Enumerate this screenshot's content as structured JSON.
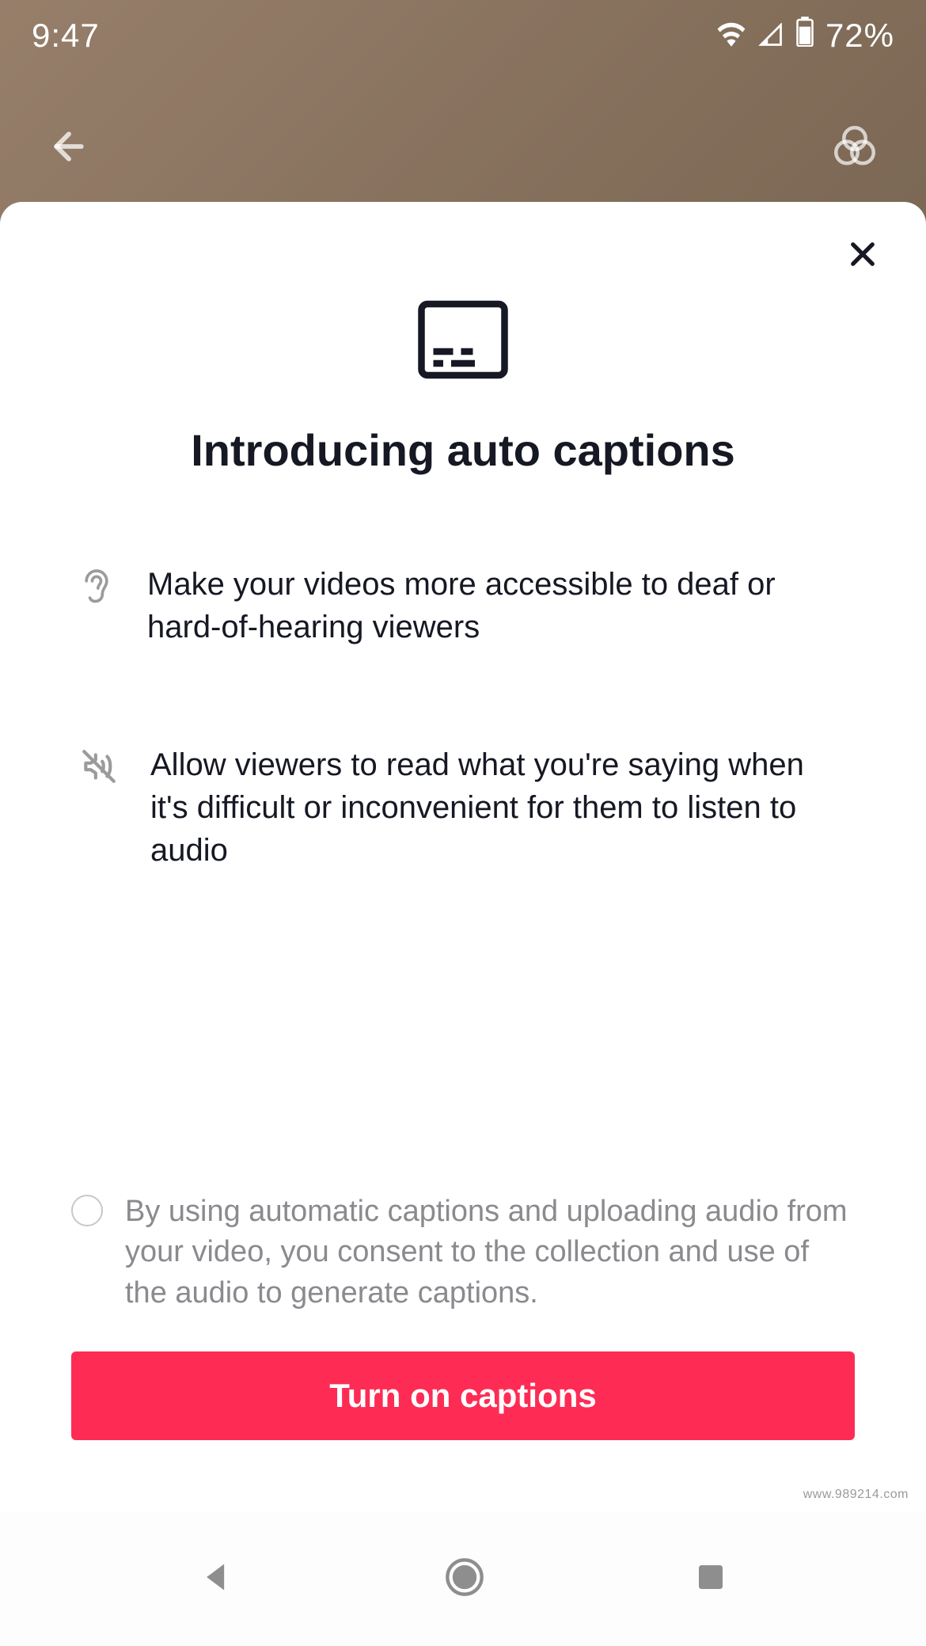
{
  "status": {
    "time": "9:47",
    "battery_percent": "72%"
  },
  "sheet": {
    "title": "Introducing auto captions",
    "bullets": [
      {
        "icon": "ear-icon",
        "text": "Make your videos more accessible to deaf or hard-of-hearing viewers"
      },
      {
        "icon": "sound-off-icon",
        "text": "Allow viewers to read what you're saying when it's difficult or inconvenient for them to listen to audio"
      }
    ],
    "consent_text": "By using automatic captions and uploading audio from your video, you consent to the collection and use of the audio to generate captions.",
    "cta_label": "Turn on captions"
  },
  "watermark": "www.989214.com"
}
